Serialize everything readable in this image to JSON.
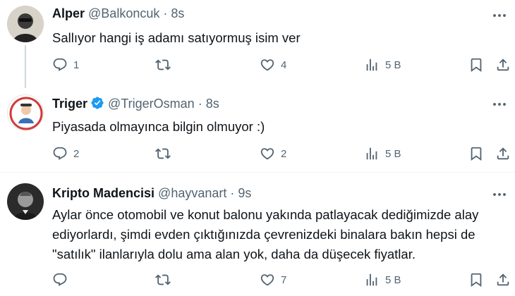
{
  "tweets": [
    {
      "name": "Alper",
      "handle": "@Balkoncuk",
      "time": "8s",
      "verified": false,
      "text": "Sallıyor hangi iş adamı satıyormuş isim ver",
      "replies": "1",
      "retweets": "",
      "likes": "4",
      "views": "5 B"
    },
    {
      "name": "Triger",
      "handle": "@TrigerOsman",
      "time": "8s",
      "verified": true,
      "text": "Piyasada olmayınca bilgin olmuyor :)",
      "replies": "2",
      "retweets": "",
      "likes": "2",
      "views": "5 B"
    },
    {
      "name": "Kripto Madencisi",
      "handle": "@hayvanart",
      "time": "9s",
      "verified": false,
      "text_lines": [
        "Aylar önce otomobil ve konut balonu yakında patlayacak dediğimizde alay",
        "ediyorlardı, şimdi evden çıktığınızda çevrenizdeki binalara bakın hepsi de",
        "\"satılık\" ilanlarıyla dolu ama alan yok, daha da düşecek fiyatlar."
      ],
      "replies": "",
      "retweets": "",
      "likes": "7",
      "views": "5 B"
    }
  ],
  "colors": {
    "text": "#0f1419",
    "secondary": "#536471",
    "verified": "#1d9bf0",
    "divider": "#eff3f4",
    "thread_line": "#cfd9de"
  },
  "icons": [
    "reply-icon",
    "retweet-icon",
    "like-icon",
    "views-icon",
    "bookmark-icon",
    "share-icon",
    "more-icon",
    "verified-badge-icon"
  ]
}
